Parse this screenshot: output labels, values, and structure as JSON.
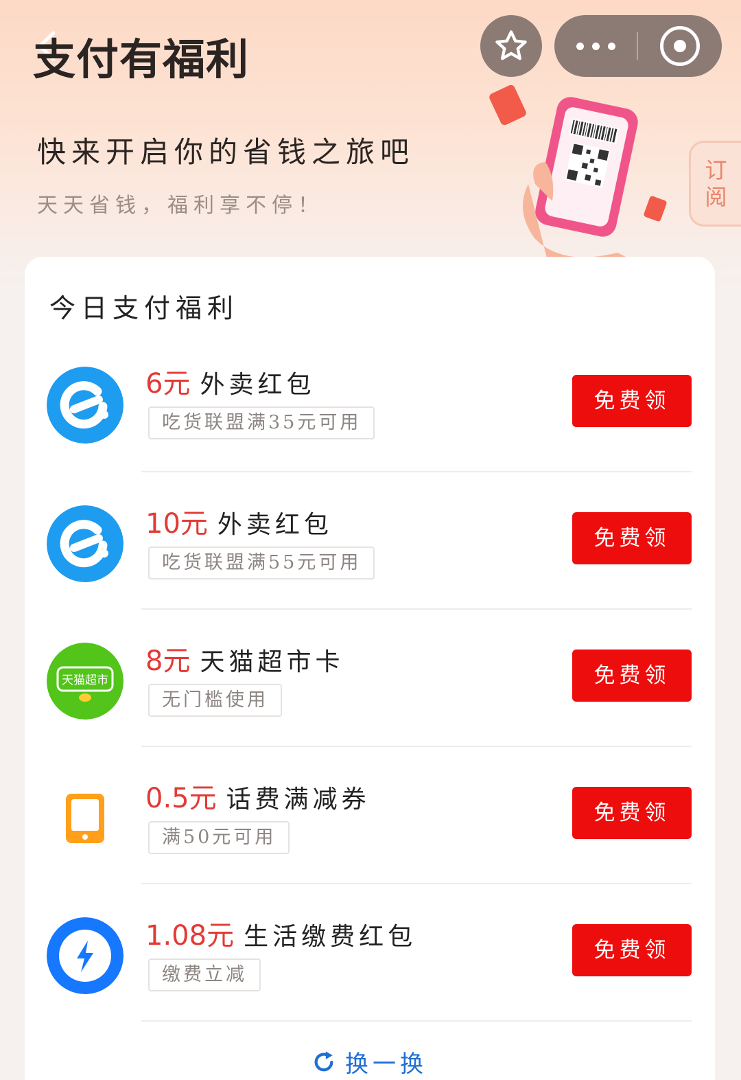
{
  "header": {
    "title": "支付有福利",
    "slogan": "快来开启你的省钱之旅吧",
    "sub_slogan": "天天省钱，福利享不停！",
    "subscribe_line1": "订",
    "subscribe_line2": "阅"
  },
  "section": {
    "title": "今日支付福利"
  },
  "items": [
    {
      "amount": "6元",
      "name": "外卖红包",
      "condition": "吃货联盟满35元可用",
      "button": "免费领",
      "icon": "eleme-icon",
      "color": "#1d9cf0"
    },
    {
      "amount": "10元",
      "name": "外卖红包",
      "condition": "吃货联盟满55元可用",
      "button": "免费领",
      "icon": "eleme-icon",
      "color": "#1d9cf0"
    },
    {
      "amount": "8元",
      "name": "天猫超市卡",
      "condition": "无门槛使用",
      "button": "免费领",
      "icon": "tmall-supermarket-icon",
      "color": "#52c41a",
      "logo_text": "天猫超市"
    },
    {
      "amount": "0.5元",
      "name": "话费满减券",
      "condition": "满50元可用",
      "button": "免费领",
      "icon": "phone-icon",
      "color": "#ff9f1a"
    },
    {
      "amount": "1.08元",
      "name": "生活缴费红包",
      "condition": "缴费立减",
      "button": "免费领",
      "icon": "lightning-icon",
      "color": "#1677ff"
    }
  ],
  "refresh": {
    "label": "换一换"
  },
  "colors": {
    "accent_red": "#ee0d0d",
    "amount_red": "#e33a35",
    "link_blue": "#1f6ed4"
  }
}
